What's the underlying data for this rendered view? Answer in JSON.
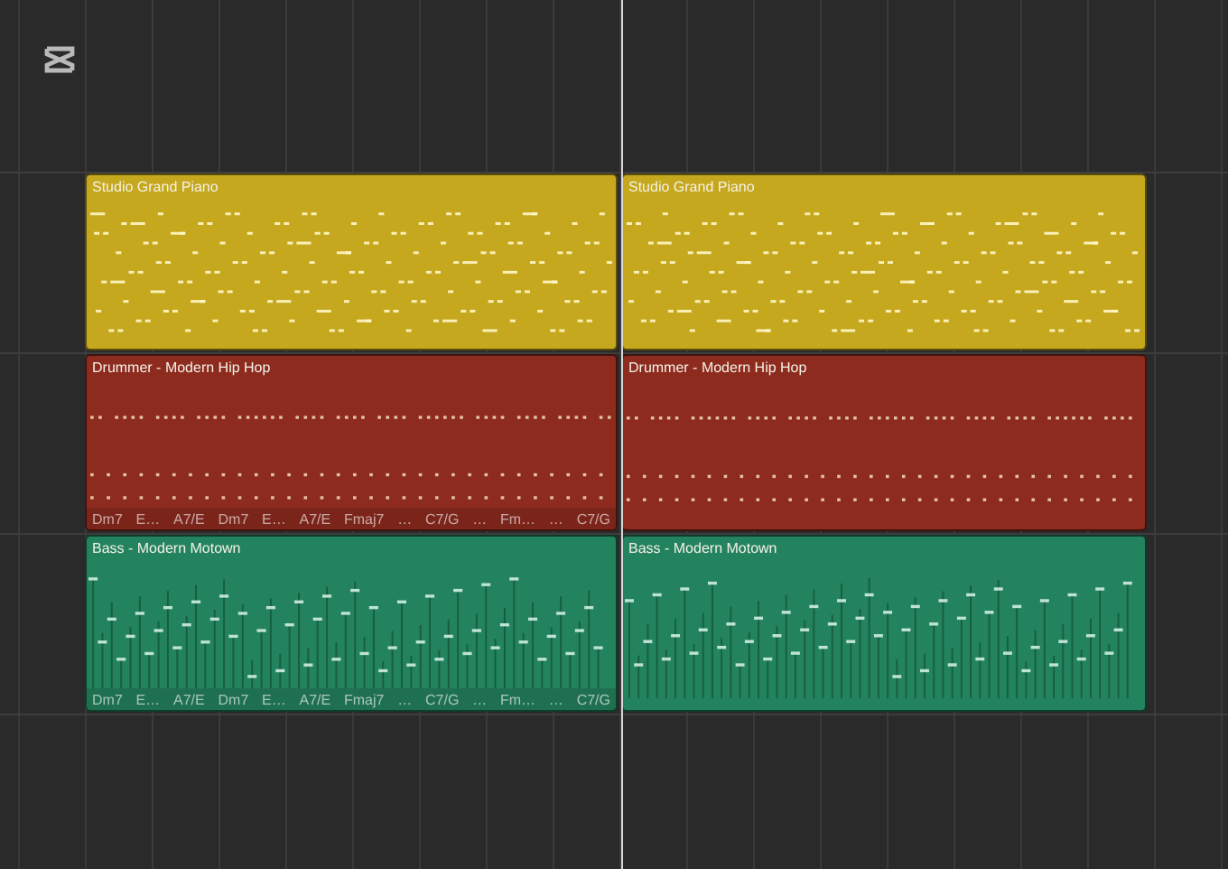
{
  "tracks": [
    {
      "kind": "piano",
      "regions": [
        {
          "title": "Studio Grand Piano",
          "color": "#c5a81e"
        },
        {
          "title": "Studio Grand Piano",
          "color": "#c5a81e"
        }
      ]
    },
    {
      "kind": "drums",
      "regions": [
        {
          "title": "Drummer - Modern Hip Hop",
          "color": "#8e2b1f",
          "chords": [
            "Dm7",
            "E…",
            "A7/E",
            "Dm7",
            "E…",
            "A7/E",
            "Fmaj7",
            "…",
            "C7/G",
            "…",
            "Fm…",
            "…",
            "C7/G"
          ]
        },
        {
          "title": "Drummer - Modern Hip Hop",
          "color": "#8e2b1f"
        }
      ]
    },
    {
      "kind": "bass",
      "regions": [
        {
          "title": "Bass - Modern Motown",
          "color": "#23835e",
          "chords": [
            "Dm7",
            "E…",
            "A7/E",
            "Dm7",
            "E…",
            "A7/E",
            "Fmaj7",
            "…",
            "C7/G",
            "…",
            "Fm…",
            "…",
            "C7/G"
          ]
        },
        {
          "title": "Bass - Modern Motown",
          "color": "#23835e"
        }
      ]
    }
  ]
}
